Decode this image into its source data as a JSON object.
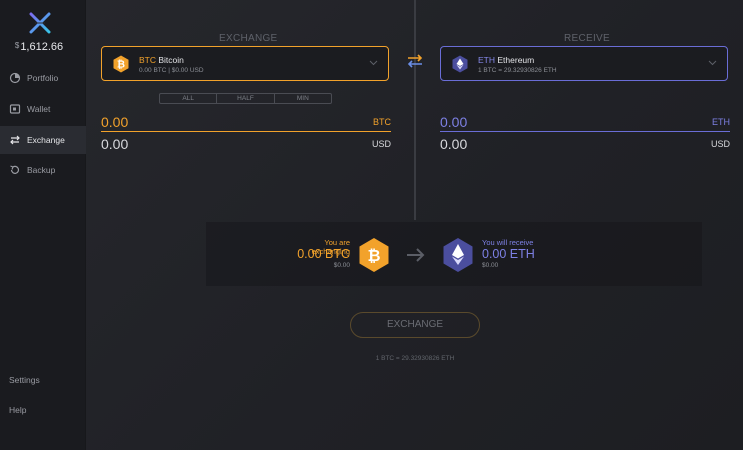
{
  "sidebar": {
    "balance_currency": "$",
    "balance_amount": "1,612.66",
    "nav": [
      {
        "label": "Portfolio",
        "icon": "portfolio-icon"
      },
      {
        "label": "Wallet",
        "icon": "wallet-icon"
      },
      {
        "label": "Exchange",
        "icon": "exchange-icon",
        "active": true
      },
      {
        "label": "Backup",
        "icon": "backup-icon"
      }
    ],
    "settings_label": "Settings",
    "help_label": "Help"
  },
  "exchange": {
    "title": "EXCHANGE",
    "asset_ticker": "BTC",
    "asset_name": "Bitcoin",
    "asset_balance": "0.00 BTC  |  $0.00 USD",
    "pct_buttons": [
      "ALL",
      "HALF",
      "MIN"
    ],
    "amount_crypto": "0.00",
    "amount_crypto_unit": "BTC",
    "amount_fiat": "0.00",
    "amount_fiat_unit": "USD"
  },
  "receive": {
    "title": "RECEIVE",
    "asset_ticker": "ETH",
    "asset_name": "Ethereum",
    "asset_rate": "1 BTC  =  29.32930826 ETH",
    "amount_crypto": "0.00",
    "amount_crypto_unit": "ETH",
    "amount_fiat": "0.00",
    "amount_fiat_unit": "USD"
  },
  "summary": {
    "exchanging_label": "You are exchanging",
    "exchanging_amount": "0.00 BTC",
    "exchanging_usd": "$0.00",
    "receive_label": "You will receive",
    "receive_amount": "0.00 ETH",
    "receive_usd": "$0.00"
  },
  "action": {
    "button_label": "EXCHANGE",
    "rate_text": "1 BTC = 29.32930826 ETH"
  },
  "colors": {
    "btc": "#f2a22b",
    "eth": "#6a6dd6",
    "background": "#1e1f24"
  }
}
